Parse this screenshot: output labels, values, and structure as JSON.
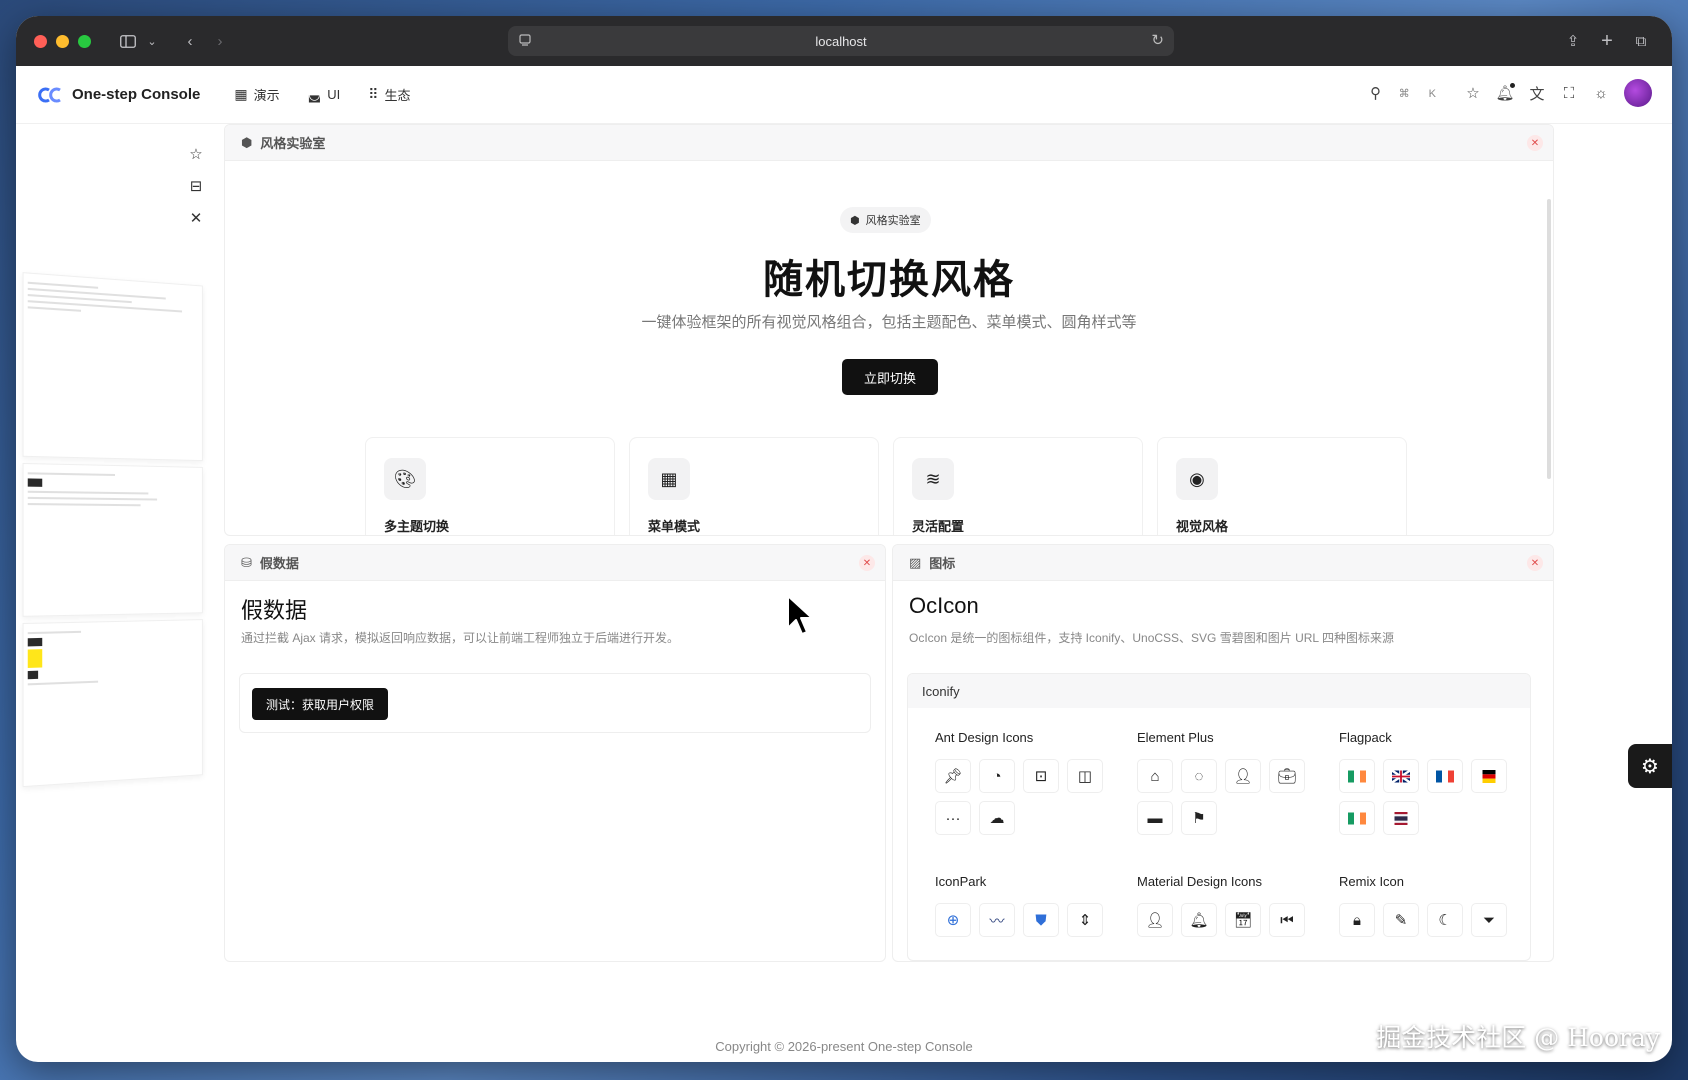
{
  "browser": {
    "url": "localhost"
  },
  "app": {
    "name": "One-step Console",
    "nav": [
      {
        "label": "演示",
        "icon": "dashboard-icon"
      },
      {
        "label": "UI",
        "icon": "ui-icon"
      },
      {
        "label": "生态",
        "icon": "grid-icon"
      }
    ],
    "search_shortcut": "⌘ K"
  },
  "style_panel": {
    "tab": "风格实验室",
    "chip": "风格实验室",
    "title": "随机切换风格",
    "subtitle": "一键体验框架的所有视觉风格组合，包括主题配色、菜单模式、圆角样式等",
    "button": "立即切换",
    "features": [
      {
        "label": "多主题切换",
        "icon": "palette-icon"
      },
      {
        "label": "菜单模式",
        "icon": "grid-icon"
      },
      {
        "label": "灵活配置",
        "icon": "layers-icon"
      },
      {
        "label": "视觉风格",
        "icon": "eye-icon"
      }
    ]
  },
  "mock_panel": {
    "tab": "假数据",
    "title": "假数据",
    "desc": "通过拦截 Ajax 请求，模拟返回响应数据，可以让前端工程师独立于后端进行开发。",
    "button": "测试：获取用户权限"
  },
  "icon_panel": {
    "tab": "图标",
    "title": "OcIcon",
    "desc": "OcIcon 是统一的图标组件，支持 Iconify、UnoCSS、SVG 雪碧图和图片 URL 四种图标来源",
    "section": "Iconify",
    "sets": [
      {
        "name": "Ant Design Icons"
      },
      {
        "name": "Element Plus"
      },
      {
        "name": "Flagpack"
      },
      {
        "name": "IconPark"
      },
      {
        "name": "Material Design Icons"
      },
      {
        "name": "Remix Icon"
      }
    ]
  },
  "footer": "Copyright © 2026-present One-step Console",
  "watermark": "掘金技术社区 @ Hooray"
}
